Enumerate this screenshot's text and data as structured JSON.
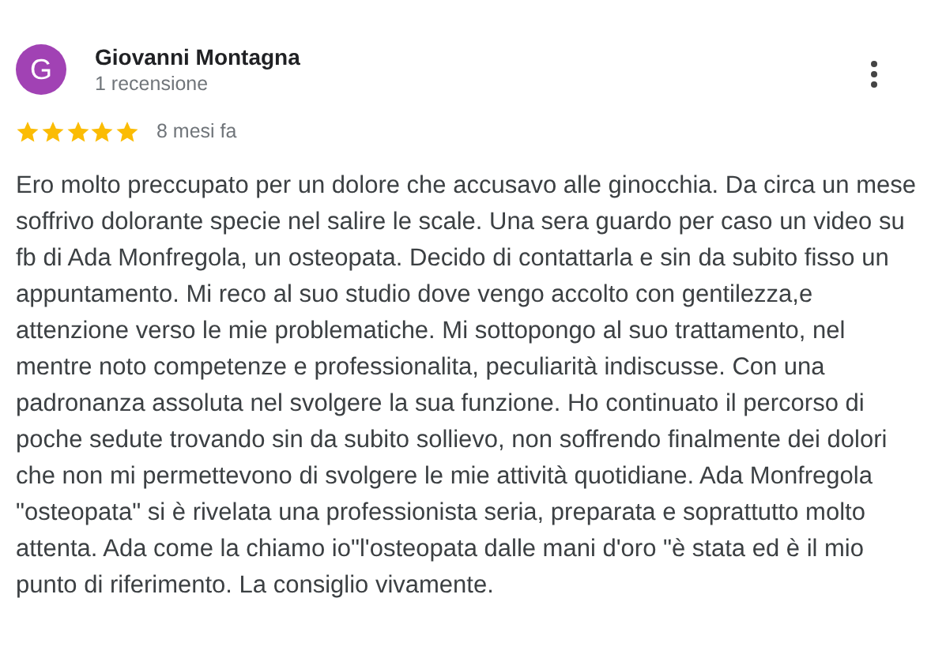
{
  "review": {
    "avatar_letter": "G",
    "author": "Giovanni Montagna",
    "author_meta": "1 recensione",
    "stars": 5,
    "time": "8 mesi fa",
    "text": "Ero molto preccupato per un dolore che accusavo alle ginocchia. Da circa un mese soffrivo dolorante specie nel salire le scale. Una sera guardo per caso un video su fb di Ada Monfregola, un osteopata. Decido di contattarla e sin da subito fisso un appuntamento. Mi reco al suo studio dove vengo accolto con gentilezza,e attenzione verso le mie problematiche. Mi sottopongo al suo trattamento, nel mentre noto competenze e professionalita, peculiarità indiscusse. Con una padronanza assoluta nel svolgere la sua funzione. Ho continuato il percorso di poche sedute trovando sin da subito sollievo, non soffrendo finalmente dei dolori che non mi permettevono di svolgere le mie attività quotidiane. Ada Monfregola \"osteopata\" si è rivelata una professionista seria, preparata e soprattutto molto attenta. Ada come la chiamo io\"l'osteopata dalle mani d'oro \"è stata ed è il mio punto di riferimento. La consiglio vivamente."
  }
}
